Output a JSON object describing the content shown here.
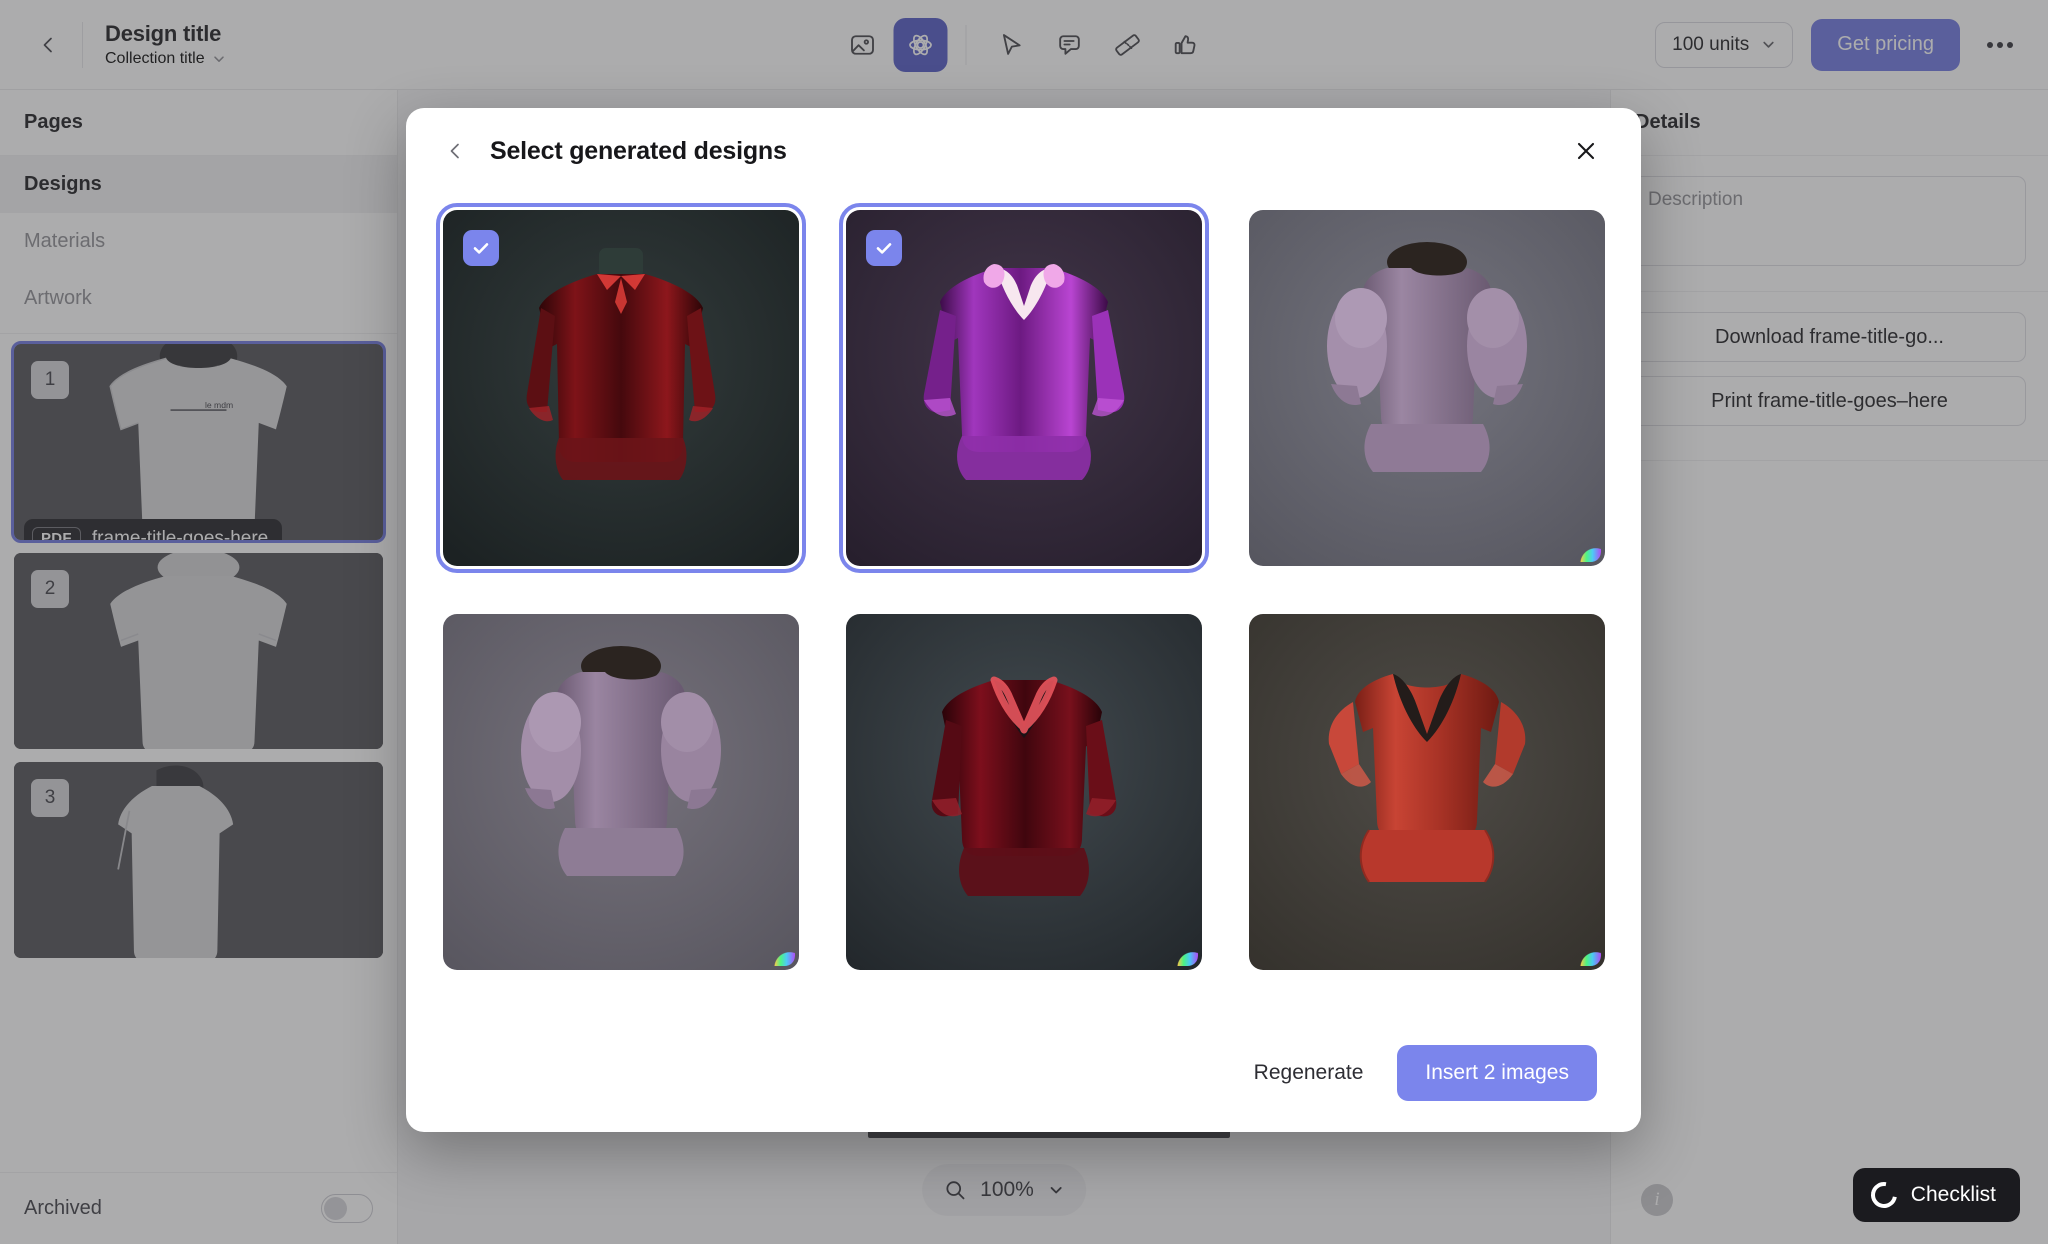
{
  "topbar": {
    "back_icon": "chevron-left-icon",
    "design_title": "Design title",
    "collection_title": "Collection title",
    "collection_chevron_icon": "chevron-down-icon",
    "tools": [
      {
        "name": "image-tool",
        "icon": "image-icon",
        "active": false
      },
      {
        "name": "ai-tool",
        "icon": "atom-icon",
        "active": true
      },
      {
        "name": "select-tool",
        "icon": "cursor-icon",
        "active": false
      },
      {
        "name": "comment-tool",
        "icon": "comment-icon",
        "active": false
      },
      {
        "name": "measure-tool",
        "icon": "ruler-icon",
        "active": false
      },
      {
        "name": "approve-tool",
        "icon": "thumbs-up-icon",
        "active": false
      }
    ],
    "units_value": "100 units",
    "units_chevron_icon": "chevron-down-icon",
    "get_pricing_label": "Get pricing",
    "more_icon": "ellipsis-icon"
  },
  "sidebar": {
    "header": "Pages",
    "nav": [
      {
        "label": "Designs",
        "selected": true
      },
      {
        "label": "Materials",
        "selected": false
      },
      {
        "label": "Artwork",
        "selected": false
      }
    ],
    "thumbnails": [
      {
        "badge": "1",
        "selected": true,
        "view": "front"
      },
      {
        "badge": "2",
        "selected": false,
        "view": "back"
      },
      {
        "badge": "3",
        "selected": false,
        "view": "side"
      }
    ],
    "tooltip": {
      "chip": "PDF",
      "label": "frame-title-goes-here"
    },
    "archived_label": "Archived",
    "archived_on": false
  },
  "canvas": {
    "zoom_icon": "search-icon",
    "zoom_value": "100%",
    "zoom_chevron_icon": "chevron-down-icon"
  },
  "right_panel": {
    "header": "Details",
    "description_placeholder": "Description",
    "description_value": "",
    "buttons": [
      {
        "label": "Download frame-title-go...",
        "name": "download-button"
      },
      {
        "label": "Print frame-title-goes–here",
        "name": "print-button"
      }
    ],
    "info_icon": "info-icon",
    "info_glyph": "i"
  },
  "checklist": {
    "label": "Checklist",
    "icon": "progress-ring-icon"
  },
  "modal": {
    "back_icon": "chevron-left-icon",
    "title": "Select generated designs",
    "close_icon": "close-icon",
    "regenerate_label": "Regenerate",
    "insert_label": "Insert 2 images",
    "selected_count": 2,
    "watermark_icon": "ai-watermark-icon",
    "check_icon": "check-icon",
    "tiles": [
      {
        "id": 1,
        "selected": true,
        "style": "mock-neck-red-velvet",
        "bg_a": "#2b3334",
        "bg_b": "#1d2324",
        "body": "#6b1418",
        "accent": "#e8413c",
        "neck": "#2e3c38",
        "silhouette": "peplum-long-sleeve",
        "watermark": false
      },
      {
        "id": 2,
        "selected": true,
        "style": "purple-velvet-v-neck",
        "bg_a": "#3a2f3e",
        "bg_b": "#2a2130",
        "body": "#8e2fa8",
        "accent": "#f0a8e8",
        "neck": "#f7e7ef",
        "silhouette": "flare-long-sleeve",
        "watermark": false
      },
      {
        "id": 3,
        "selected": false,
        "style": "mauve-puff-sleeve",
        "bg_a": "#6a6a74",
        "bg_b": "#595963",
        "body": "#8f7a96",
        "accent": "#a991ae",
        "neck": "#2b2420",
        "silhouette": "puff-sleeve-peplum",
        "watermark": true
      },
      {
        "id": 4,
        "selected": false,
        "style": "mauve-puff-sleeve-2",
        "bg_a": "#6e6a74",
        "bg_b": "#5c5a63",
        "body": "#8e7c95",
        "accent": "#a893ad",
        "neck": "#2b2420",
        "silhouette": "puff-sleeve-peplum",
        "watermark": true
      },
      {
        "id": 5,
        "selected": false,
        "style": "dark-red-velvet-v-neck",
        "bg_a": "#3a4044",
        "bg_b": "#23282c",
        "body": "#5e0f18",
        "accent": "#e8545c",
        "neck": "#1a1216",
        "silhouette": "flare-long-sleeve",
        "watermark": true
      },
      {
        "id": 6,
        "selected": false,
        "style": "red-flutter-sleeve",
        "bg_a": "#4a4744",
        "bg_b": "#38352f",
        "body": "#b8382c",
        "accent": "#d75a48",
        "neck": "#231c1a",
        "silhouette": "flutter-peplum",
        "watermark": true
      }
    ]
  },
  "colors": {
    "accent": "#6b74e0",
    "accent_soft": "#7b85ec",
    "text": "#17171a",
    "muted": "#8a8a90",
    "dark": "#1b1b1f"
  }
}
